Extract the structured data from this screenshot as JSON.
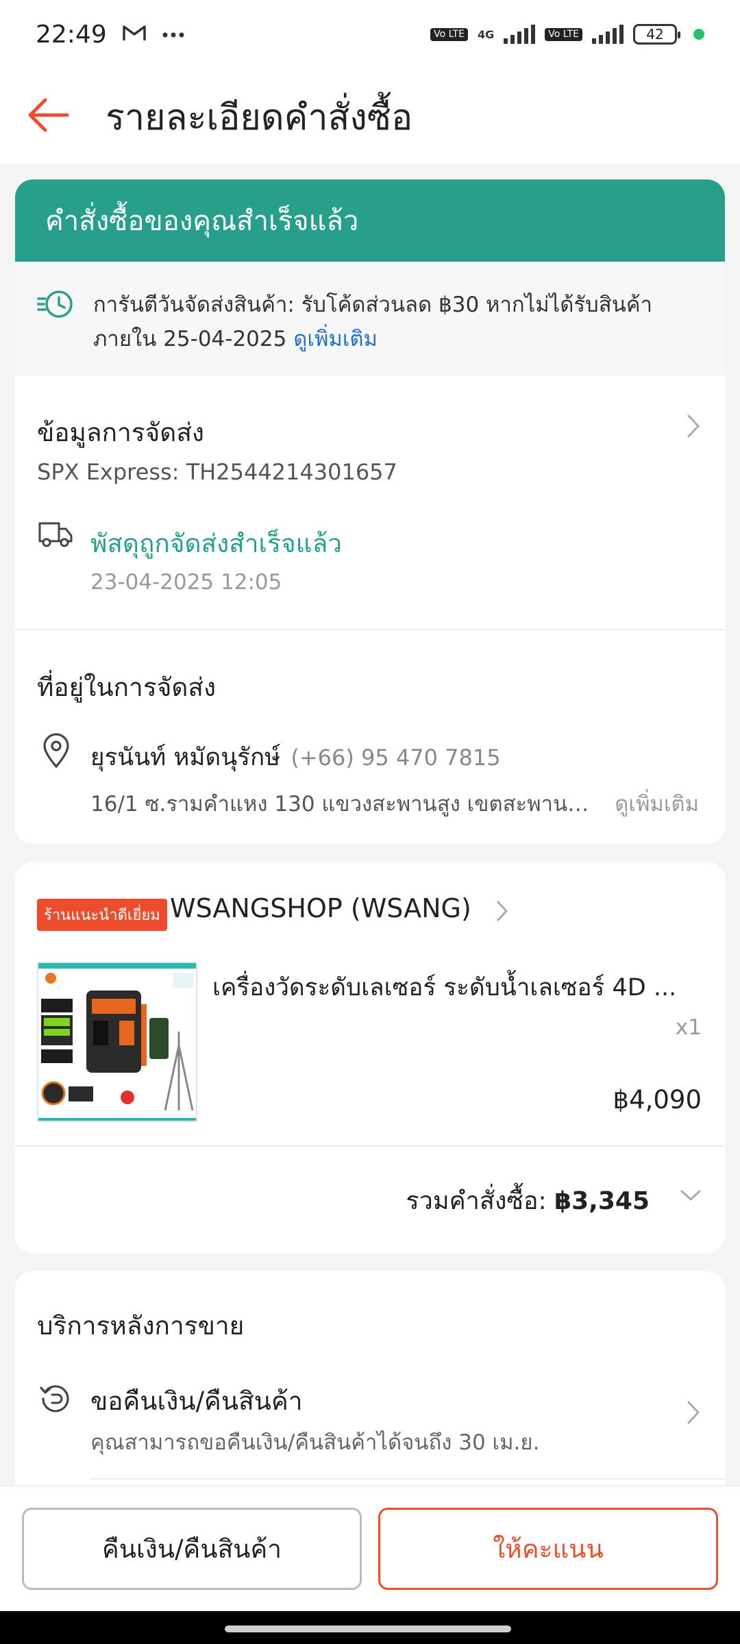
{
  "status_bar": {
    "time": "22:49",
    "icons": [
      "gmail-icon",
      "more-dots-icon",
      "volte-icon",
      "signal-icon",
      "battery-icon"
    ],
    "network": "4G",
    "lte_label": "Vo LTE",
    "battery": "42"
  },
  "header": {
    "title": "รายละเอียดคำสั่งซื้อ",
    "back_icon": "back-arrow-icon"
  },
  "order_status": {
    "banner_text": "คำสั่งซื้อของคุณสำเร็จแล้ว",
    "guarantee_text": "การันตีวันจัดส่งสินค้า: รับโค้ดส่วนลด ฿30 หากไม่ได้รับสินค้าภายใน 25-04-2025",
    "guarantee_link": "ดูเพิ่มเติม"
  },
  "shipping": {
    "title": "ข้อมูลการจัดส่ง",
    "tracking": "SPX Express: TH2544214301657",
    "status": "พัสดุถูกจัดส่งสำเร็จแล้ว",
    "status_time": "23-04-2025 12:05"
  },
  "address": {
    "title": "ที่อยู่ในการจัดส่ง",
    "name": "ยุรนันท์ หมัดนุรักษ์",
    "phone": "(+66) 95 470 7815",
    "line": "16/1 ซ.รามคำแหง 130 แขวงสะพานสูง เขตสะพานสู...",
    "more": "ดูเพิ่มเติม"
  },
  "shop": {
    "badge": "ร้านแนะนำดีเยี่ยม",
    "name": "WSANGSHOP (WSANG)",
    "product": {
      "title": "เครื่องวัดระดับเลเซอร์ ระดับน้ำเลเซอร์ 4D ...",
      "qty": "x1",
      "price": "฿4,090"
    },
    "order_total_label": "รวมคำสั่งซื้อ:",
    "order_total_value": "฿3,345"
  },
  "after_sales": {
    "title": "บริการหลังการขาย",
    "refund_label": "ขอคืนเงิน/คืนสินค้า",
    "refund_desc": "คุณสามารถขอคืนเงิน/คืนสินค้าได้จนถึง 30 เม.ย."
  },
  "actions": {
    "refund_button": "คืนเงิน/คืนสินค้า",
    "rate_button": "ให้คะแนน"
  },
  "colors": {
    "primary": "#ee4d2d",
    "success": "#26a08a",
    "link": "#1f6fd1"
  }
}
